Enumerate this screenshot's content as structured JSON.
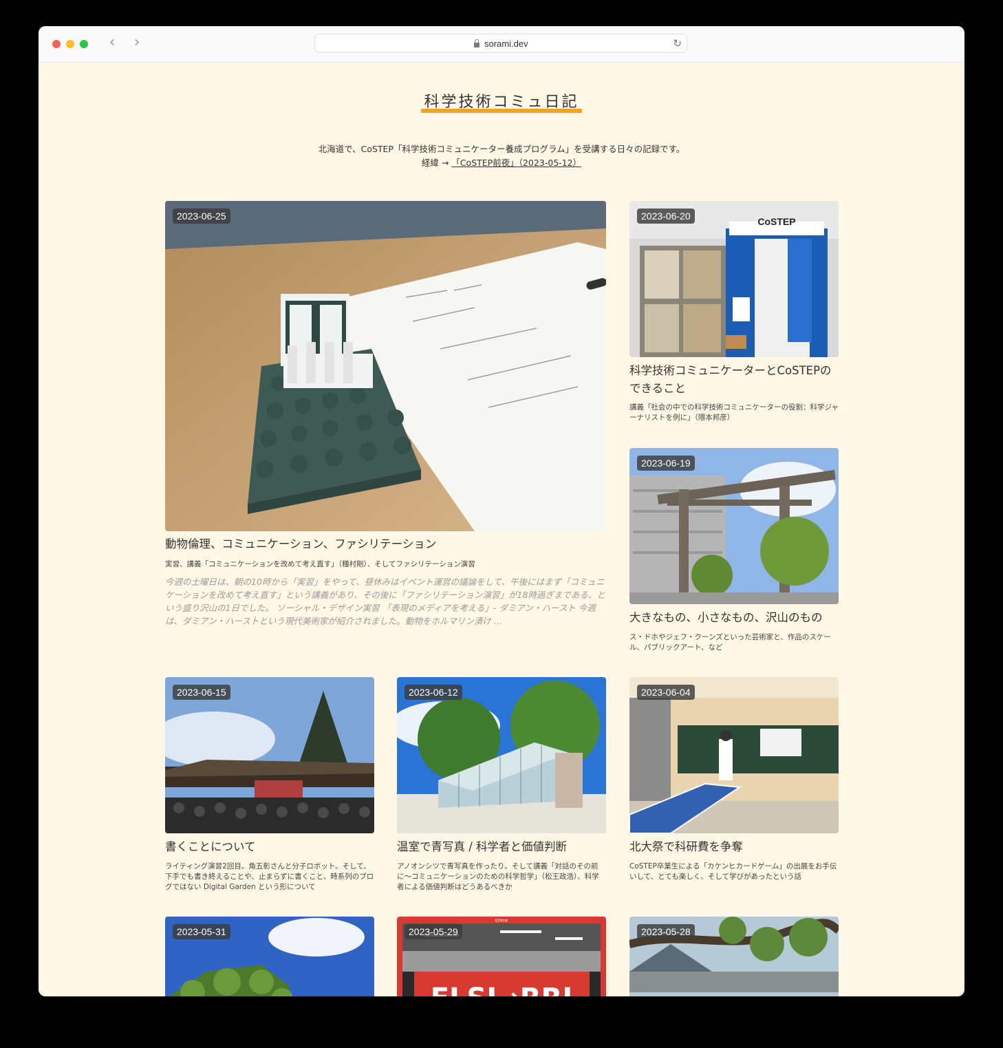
{
  "browser": {
    "url": "sorami.dev"
  },
  "site": {
    "title": "科学技術コミュ日記",
    "intro_line1": "北海道で、CoSTEP「科学技術コミュニケーター養成プログラム」を受講する日々の記録です。",
    "intro_prefix": "経緯 → ",
    "intro_link": "「CoSTEP前夜」（2023-05-12）"
  },
  "posts": [
    {
      "date": "2023-06-25",
      "title": "動物倫理、コミュニケーション、ファシリテーション",
      "subtitle": "実習、講義「コミュニケーションを改めて考え直す」（種村剛）、そしてファシリテーション演習",
      "excerpt": "今週の土曜日は、朝の10時から「実習」をやって、昼休みはイベント運営の議論をして、午後にはまず「コミュニケーションを改めて考え直す」という講義があり、その後に「ファシリテーション演習」が18時過ぎまである、という盛り沢山の1日でした。 ソーシャル・デザイン実習 「表現のメディアを考える」- ダミアン・ハースト 今週は、ダミアン・ハーストという現代美術家が紹介されました。動物をホルマリン漬け …"
    },
    {
      "date": "2023-06-20",
      "title": "科学技術コミュニケーターとCoSTEPのできること",
      "subtitle": "講義「社会の中での科学技術コミュニケーターの役割：科学ジャーナリストを例に」（隈本邦彦）",
      "photo_sign": "CoSTEP"
    },
    {
      "date": "2023-06-19",
      "title": "大きなもの、小さなもの、沢山のもの",
      "subtitle": "ス・ドホやジェフ・クーンズといった芸術家と、作品のスケール、パブリックアート、など"
    },
    {
      "date": "2023-06-15",
      "title": "書くことについて",
      "subtitle": "ライティング演習2回目。角五彰さんと分子ロボット。そして、下手でも書き終えることや、止まらずに書くこと、時系列のブログではない Digital Garden という形について"
    },
    {
      "date": "2023-06-12",
      "title": "温室で青写真 / 科学者と価値判断",
      "subtitle": "アノオンシツで青写真を作ったり。そして講義「対話のその前に〜コミュニケーションのための科学哲学」（松王政浩）、科学者による価値判断はどうあるべきか"
    },
    {
      "date": "2023-06-04",
      "title": "北大祭で科研費を争奪",
      "subtitle": "CoSTEP卒業生による「カケンヒカードゲーム」の出展をお手伝いして、とても楽しく、そして学びがあったという話"
    },
    {
      "date": "2023-05-31"
    },
    {
      "date": "2023-05-29",
      "photo_label_top": "Ethical",
      "photo_banner": "ELSI→RRI"
    },
    {
      "date": "2023-05-28"
    }
  ]
}
